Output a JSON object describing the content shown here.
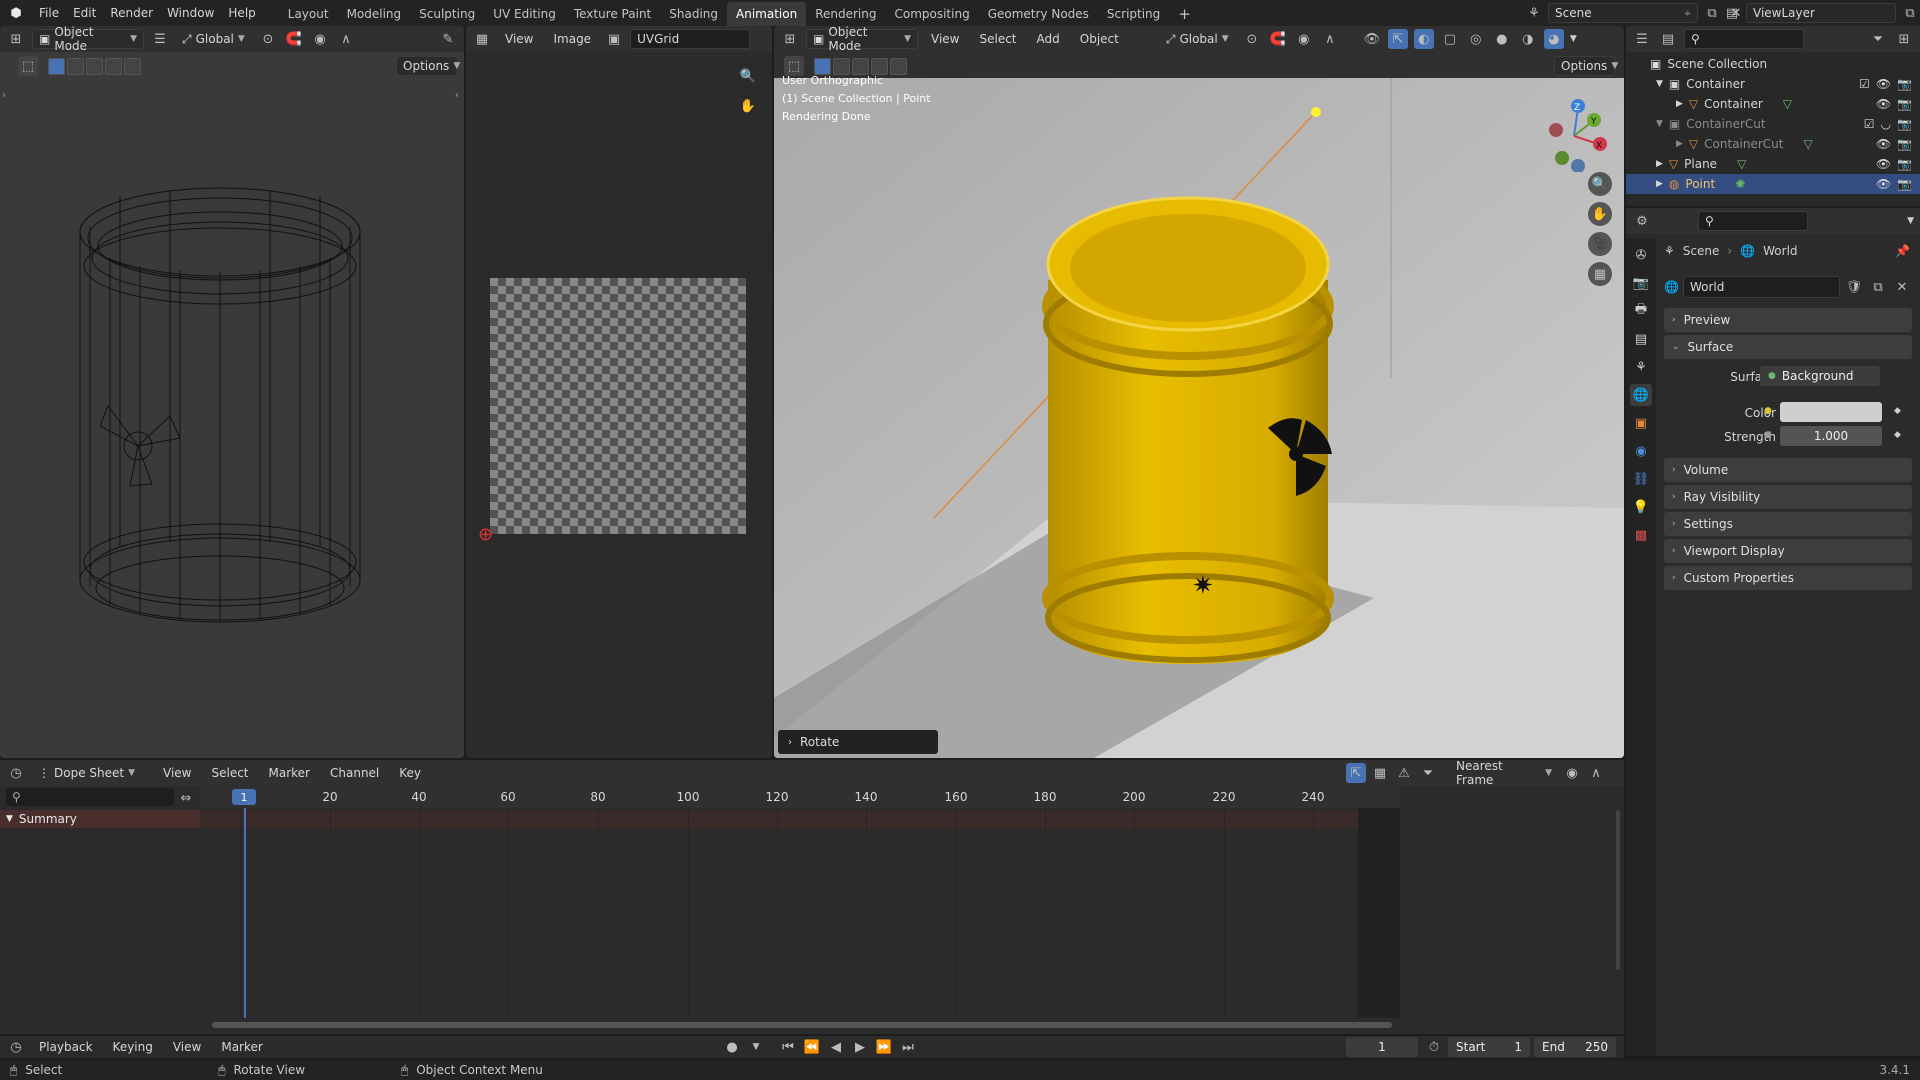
{
  "topbar": {
    "menus": [
      "File",
      "Edit",
      "Render",
      "Window",
      "Help"
    ],
    "workspaces": [
      "Layout",
      "Modeling",
      "Sculpting",
      "UV Editing",
      "Texture Paint",
      "Shading",
      "Animation",
      "Rendering",
      "Compositing",
      "Geometry Nodes",
      "Scripting"
    ],
    "active_workspace": "Animation",
    "add_tab": "+",
    "scene_name": "Scene",
    "view_layer": "ViewLayer"
  },
  "left_viewport": {
    "mode": "Object Mode",
    "orientation": "Global",
    "options": "Options"
  },
  "image_editor": {
    "menus": [
      "View",
      "Image"
    ],
    "image_name": "UVGrid"
  },
  "main_viewport": {
    "mode": "Object Mode",
    "menus": [
      "View",
      "Select",
      "Add",
      "Object"
    ],
    "orientation": "Global",
    "options": "Options",
    "overlay_line1": "User Orthographic",
    "overlay_line2": "(1) Scene Collection | Point",
    "overlay_line3": "Rendering Done",
    "last_op": "Rotate",
    "gizmo_labels": {
      "z": "Z",
      "y": "Y",
      "x": "X"
    },
    "colors": {
      "barrel": "#e0b400",
      "floor": "#d0d0d0",
      "sky": "#b9b9b9",
      "light_line": "#e08a3a"
    }
  },
  "outliner": {
    "root": "Scene Collection",
    "rows": [
      {
        "label": "Container",
        "type": "collection",
        "depth": 1
      },
      {
        "label": "Container",
        "type": "mesh",
        "depth": 2
      },
      {
        "label": "ContainerCut",
        "type": "collection",
        "depth": 1
      },
      {
        "label": "ContainerCut",
        "type": "mesh",
        "depth": 2
      },
      {
        "label": "Plane",
        "type": "mesh",
        "depth": 1
      },
      {
        "label": "Point",
        "type": "light",
        "depth": 1,
        "selected": true
      }
    ]
  },
  "properties": {
    "breadcrumb_scene": "Scene",
    "breadcrumb_world": "World",
    "world_name": "World",
    "sections": [
      "Preview",
      "Surface",
      "Volume",
      "Ray Visibility",
      "Settings",
      "Viewport Display",
      "Custom Properties"
    ],
    "surface_label": "Surface",
    "surface_value": "Background",
    "color_label": "Color",
    "strength_label": "Strength",
    "strength_value": "1.000",
    "colors": {
      "world_color": "#cfcfcf"
    }
  },
  "dopesheet": {
    "editor": "Dope Sheet",
    "menus": [
      "View",
      "Select",
      "Marker",
      "Channel",
      "Key"
    ],
    "snap": "Nearest Frame",
    "current_frame": "1",
    "ticks": [
      "20",
      "40",
      "60",
      "80",
      "100",
      "120",
      "140",
      "160",
      "180",
      "200",
      "220",
      "240"
    ],
    "channel": "Summary"
  },
  "timeline": {
    "menus": [
      "Playback",
      "Keying",
      "View",
      "Marker"
    ],
    "frame": "1",
    "start_label": "Start",
    "start_value": "1",
    "end_label": "End",
    "end_value": "250"
  },
  "statusbar": {
    "select": "Select",
    "rotate_view": "Rotate View",
    "context_menu": "Object Context Menu",
    "version": "3.4.1"
  }
}
